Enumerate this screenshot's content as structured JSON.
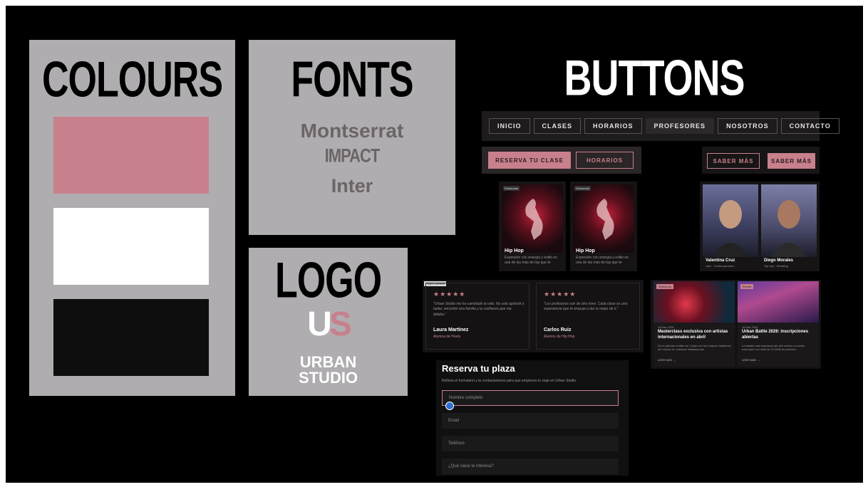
{
  "colours": {
    "title": "COLOURS",
    "swatches": [
      "#c8808c",
      "#ffffff",
      "#0e0e0e"
    ]
  },
  "fonts": {
    "title": "FONTS",
    "samples": [
      "Montserrat",
      "IMPACT",
      "Inter"
    ]
  },
  "logo": {
    "title": "LOGO",
    "mark_letters": "US",
    "line1": "URBAN",
    "line2": "STUDIO"
  },
  "buttons": {
    "title": "BUTTONS",
    "nav": [
      "INICIO",
      "CLASES",
      "HORARIOS",
      "PROFESORES",
      "NOSOTROS",
      "CONTACTO"
    ],
    "reserva": "RESERVA TU CLASE",
    "horarios": "HORARIOS",
    "saber1": "SABER MÁS",
    "saber2": "SABER MÁS"
  },
  "classes": [
    {
      "title": "Hip Hop",
      "desc": "Expresión con energía y estilo en una de las más de top que te apasiona",
      "tag": "Destacada"
    },
    {
      "title": "Hip Hop",
      "desc": "Expresión con energía y estilo en una de las más de top que te apasiona",
      "tag": "Destacada"
    }
  ],
  "teachers": [
    {
      "name": "Valentina Cruz",
      "role": "Jazz · Contemporáneo"
    },
    {
      "name": "Diego Morales",
      "role": "Hip Hop · Breaking"
    }
  ],
  "testimonials": {
    "label": "Project preview",
    "stars": "★★★★★",
    "items": [
      {
        "quote": "\"Urban Studio me ha cambiado la vida. No solo aprendí a bailar, encontré una familia y la confianza que me faltaba.\"",
        "name": "Laura Martínez",
        "role": "Alumna de Heels"
      },
      {
        "quote": "\"Los profesores son de otro nivel. Cada clase es una experiencia que te empuja a dar lo mejor de ti.\"",
        "name": "Carlos Ruiz",
        "role": "Alumno de Hip Hop"
      }
    ]
  },
  "news": [
    {
      "tag": "Workshop",
      "date": "28 Mar 2026",
      "title": "Masterclass exclusiva con artistas internacionales en abril",
      "desc": "No te pierdas el taller de 3 días con los mejores bailarines del mundo en nuestras instalaciones.",
      "link": "LEER MÁS →"
    },
    {
      "tag": "Evento",
      "date": "15 Mar 2026",
      "title": "Urban Battle 2026: inscripciones abiertas",
      "desc": "La batalla más esperada del año vuelve a nuestro escenario con más de 10.000€ en premios.",
      "link": "LEER MÁS →"
    }
  ],
  "form": {
    "title": "Reserva tu plaza",
    "subtitle": "Rellena el formulario y te contactaremos para que empieces tu viaje en Urban Studio.",
    "fields": [
      "Nombre completo",
      "Email",
      "Teléfono",
      "¿Qué clase te interesa?"
    ]
  }
}
